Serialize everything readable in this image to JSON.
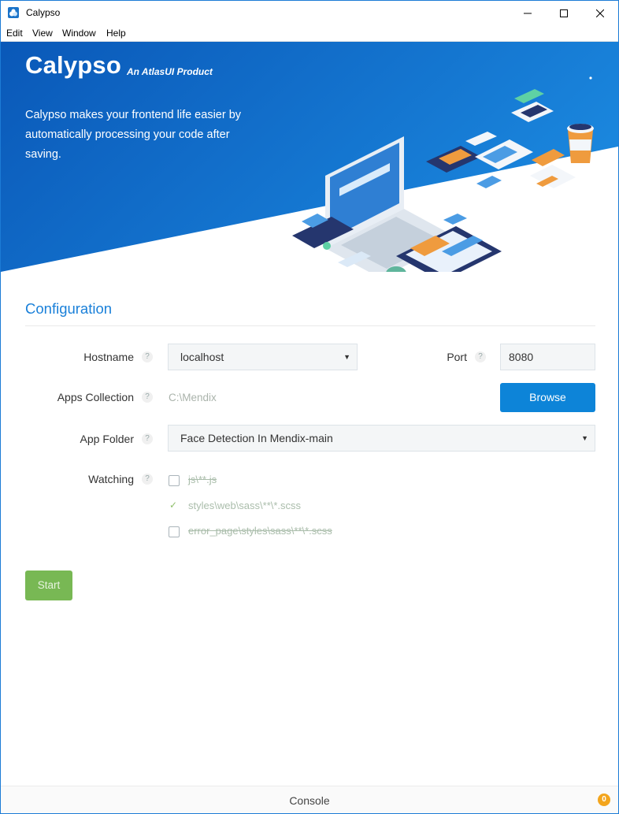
{
  "window": {
    "title": "Calypso",
    "controls": [
      "minimize-icon",
      "maximize-icon",
      "close-icon"
    ]
  },
  "menu": {
    "items": [
      "Edit",
      "View",
      "Window",
      "Help"
    ]
  },
  "hero": {
    "brand": "Calypso",
    "tagline": "An AtlasUI Product",
    "description": "Calypso makes your frontend life easier by automatically processing your code after saving.",
    "theme_icon": "moon-icon",
    "colors": {
      "gradient_start": "#0a58b8",
      "gradient_end": "#1a86dd"
    }
  },
  "config": {
    "title": "Configuration",
    "help_glyph": "?",
    "hostname": {
      "label": "Hostname",
      "value": "localhost"
    },
    "port": {
      "label": "Port",
      "value": "8080"
    },
    "apps_collection": {
      "label": "Apps Collection",
      "value": "C:\\Mendix"
    },
    "browse_label": "Browse",
    "app_folder": {
      "label": "App Folder",
      "value": "Face Detection In Mendix-main"
    },
    "watching": {
      "label": "Watching",
      "items": [
        {
          "text": "js\\**.js",
          "checked": false
        },
        {
          "text": "styles\\web\\sass\\**\\*.scss",
          "checked": true
        },
        {
          "text": "error_page\\styles\\sass\\**\\*.scss",
          "checked": false
        }
      ]
    },
    "start_label": "Start"
  },
  "console": {
    "label": "Console",
    "badge": "0"
  },
  "colors": {
    "accent": "#0d84d8",
    "start": "#78b854",
    "badge": "#f3a51d"
  }
}
